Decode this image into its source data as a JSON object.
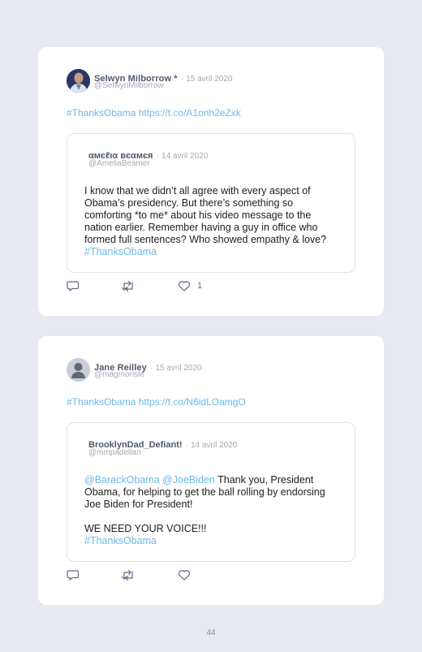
{
  "tweets": [
    {
      "author_name": "Selwyn Milborrow *",
      "date": "· 15 avril 2020",
      "handle": "@SelwynMilborrow",
      "text": "#ThanksObama https://t.co/A1onh2eZxk",
      "quoted": {
        "author_name": "αмєℓια вєαмєя",
        "date": "· 14 avril 2020",
        "handle": "@AmeliaBeamer",
        "segments": [
          {
            "text": "I know that we didn’t all agree with every aspect of Obama’s presidency. But there’s something so comforting *to me* about his video message to the nation earlier. Remember having a guy in office who formed full sentences? Who showed empathy & love? ",
            "link": false
          },
          {
            "text": "#ThanksObama",
            "link": true
          }
        ]
      },
      "like_count": "1"
    },
    {
      "author_name": "Jane Reilley",
      "date": "· 15 avril 2020",
      "handle": "@magmorisle",
      "text": "#ThanksObama https://t.co/N6idLOamgO",
      "quoted": {
        "author_name": "BrooklynDad_Defiant!",
        "date": "· 14 avril 2020",
        "handle": "@mmpadellan",
        "segments": [
          {
            "text": "@BarackObama @JoeBiden",
            "link": true
          },
          {
            "text": " Thank you, President Obama, for helping to get the ball rolling by endorsing Joe Biden for President!",
            "link": false
          },
          {
            "text": "\n\nWE NEED YOUR VOICE!!!",
            "link": false
          },
          {
            "text": "\n#ThanksObama",
            "link": true
          }
        ]
      },
      "like_count": ""
    }
  ],
  "icons": {
    "reply": "reply-icon",
    "retweet": "retweet-icon",
    "like": "heart-icon"
  },
  "colors": {
    "background": "#e8e9f1",
    "link": "#6db8e6",
    "icon": "#5b6b82"
  },
  "page_number": "44"
}
